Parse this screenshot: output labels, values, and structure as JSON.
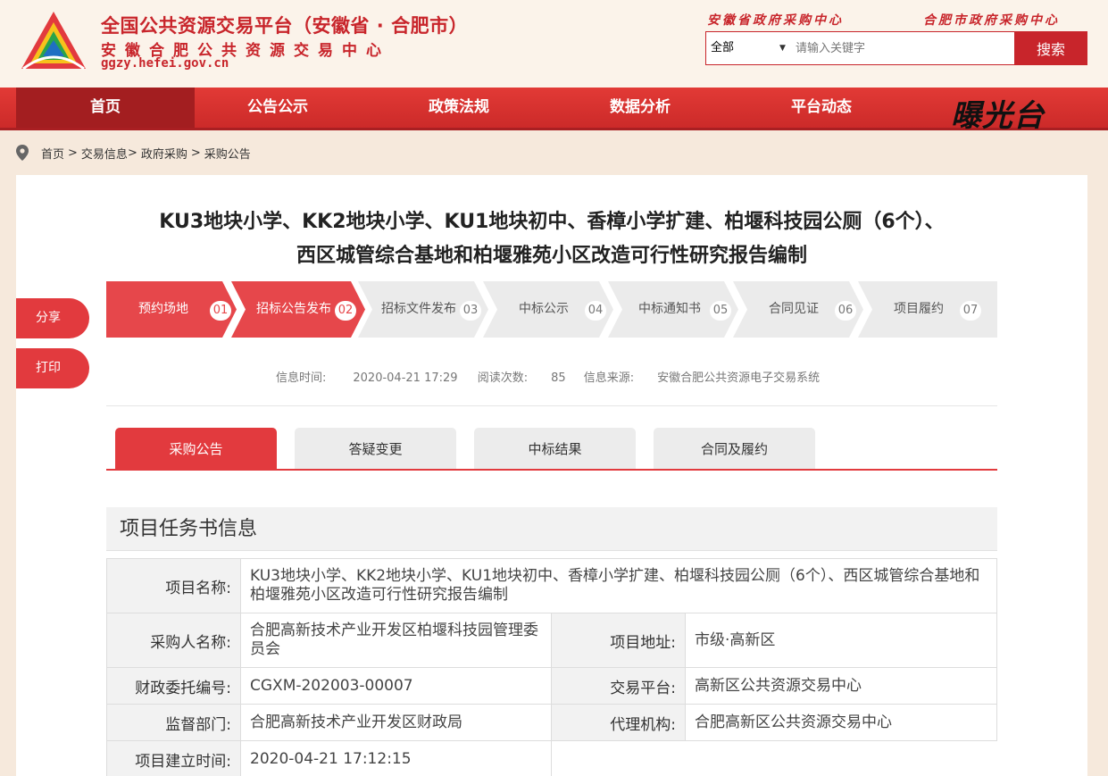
{
  "header": {
    "title": "全国公共资源交易平台（安徽省 · 合肥市）",
    "subtitle": "安徽合肥公共资源交易中心",
    "url": "ggzy.hefei.gov.cn",
    "top_links": [
      "安徽省政府采购中心",
      "合肥市政府采购中心"
    ],
    "search": {
      "select_value": "全部",
      "placeholder": "请输入关键字",
      "button": "搜索"
    }
  },
  "nav": {
    "items": [
      {
        "label": "首页",
        "active": true
      },
      {
        "label": "公告公示"
      },
      {
        "label": "政策法规"
      },
      {
        "label": "数据分析"
      },
      {
        "label": "平台动态"
      }
    ],
    "logo_text": "曝光台"
  },
  "breadcrumb": {
    "home": "首页",
    "trade": "交易信息",
    "gov": "政府采购",
    "current": "采购公告"
  },
  "doc": {
    "title_line1": "KU3地块小学、KK2地块小学、KU1地块初中、香樟小学扩建、柏堰科技园公厕（6个）、",
    "title_line2": "西区城管综合基地和柏堰雅苑小区改造可行性研究报告编制"
  },
  "side": {
    "share": "分享",
    "print": "打印"
  },
  "steps": [
    {
      "label": "预约场地",
      "num": "01",
      "done": true
    },
    {
      "label": "招标公告发布",
      "num": "02",
      "done": true
    },
    {
      "label": "招标文件发布",
      "num": "03",
      "done": false
    },
    {
      "label": "中标公示",
      "num": "04",
      "done": false
    },
    {
      "label": "中标通知书",
      "num": "05",
      "done": false
    },
    {
      "label": "合同见证",
      "num": "06",
      "done": false
    },
    {
      "label": "项目履约",
      "num": "07",
      "done": false
    }
  ],
  "meta": {
    "time_label": "信息时间:",
    "time_value": "2020-04-21 17:29",
    "reads_label": "阅读次数:",
    "reads_value": "85",
    "source_label": "信息来源:",
    "source_value": "安徽合肥公共资源电子交易系统"
  },
  "tabs": [
    {
      "label": "采购公告",
      "active": true
    },
    {
      "label": "答疑变更"
    },
    {
      "label": "中标结果"
    },
    {
      "label": "合同及履约"
    }
  ],
  "section": {
    "title": "项目任务书信息"
  },
  "info": {
    "project_name_label": "项目名称:",
    "project_name_value": "KU3地块小学、KK2地块小学、KU1地块初中、香樟小学扩建、柏堰科技园公厕（6个）、西区城管综合基地和柏堰雅苑小区改造可行性研究报告编制",
    "buyer_label": "采购人名称:",
    "buyer_value": "合肥高新技术产业开发区柏堰科技园管理委员会",
    "address_label": "项目地址:",
    "address_value": "市级·高新区",
    "code_label": "财政委托编号:",
    "code_value": "CGXM-202003-00007",
    "platform_label": "交易平台:",
    "platform_value": "高新区公共资源交易中心",
    "supervisor_label": "监督部门:",
    "supervisor_value": "合肥高新技术产业开发区财政局",
    "agent_label": "代理机构:",
    "agent_value": "合肥高新区公共资源交易中心",
    "created_label": "项目建立时间:",
    "created_value": "2020-04-21 17:12:15"
  },
  "colors": {
    "brand_red": "#c8252b",
    "nav_red": "#e23a36",
    "step_done": "#e6474b",
    "step_todo": "#ebebeb"
  }
}
